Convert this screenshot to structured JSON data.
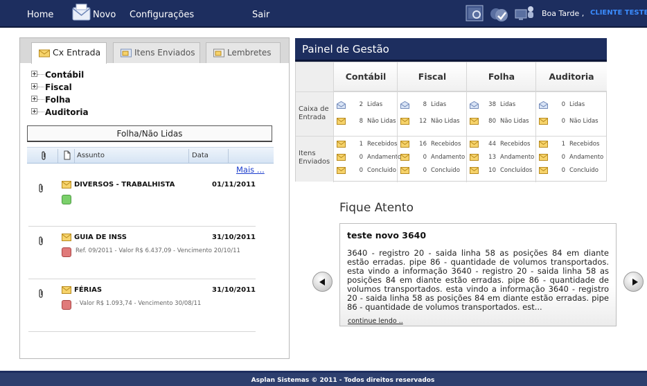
{
  "nav": {
    "home": "Home",
    "novo": "Novo",
    "config": "Configurações",
    "sair": "Sair",
    "greeting": "Boa Tarde ,",
    "client": "CLIENTE TESTE"
  },
  "tabs": [
    {
      "label": "Cx Entrada",
      "active": true
    },
    {
      "label": "Itens Enviados",
      "active": false
    },
    {
      "label": "Lembretes",
      "active": false
    }
  ],
  "tree": [
    "Contábil",
    "Fiscal",
    "Folha",
    "Auditoria"
  ],
  "folder_title": "Folha/Não Lidas",
  "grid": {
    "col_subject": "Assunto",
    "col_date": "Data",
    "more": "Mais ..."
  },
  "messages": [
    {
      "subject": "DIVERSOS - TRABALHISTA",
      "date": "01/11/2011",
      "detail": "",
      "status": "green"
    },
    {
      "subject": "GUIA DE INSS",
      "date": "31/10/2011",
      "detail": "Ref. 09/2011 - Valor R$ 6.437,09 - Vencimento 20/10/11",
      "status": "red"
    },
    {
      "subject": "FÉRIAS",
      "date": "31/10/2011",
      "detail": "- Valor R$ 1.093,74 - Vencimento 30/08/11",
      "status": "red"
    }
  ],
  "painel": {
    "title": "Painel de Gestão",
    "columns": [
      "Contábil",
      "Fiscal",
      "Folha",
      "Auditoria"
    ],
    "row_caixa": "Caixa de Entrada",
    "row_itens": "Itens Enviados",
    "lidas": [
      "2",
      "8",
      "38",
      "0"
    ],
    "nao_lidas": [
      "8",
      "12",
      "80",
      "0"
    ],
    "recebidos": [
      "1",
      "16",
      "44",
      "1"
    ],
    "andamento": [
      "0",
      "0",
      "13",
      "0"
    ],
    "concluido": [
      "0",
      "0",
      "10",
      "0"
    ],
    "labels": {
      "lidas": "Lidas",
      "nao_lidas": "Não Lidas",
      "recebidos": "Recebidos",
      "andamento": "Andamento",
      "concluido": "Concluido",
      "concluidos": "Concluídos"
    }
  },
  "fique": {
    "title": "Fique Atento",
    "news_title": "teste novo 3640",
    "news_body": "3640 - registro 20 - saida linha 58 as posições 84 em diante estão erradas. pipe 86 - quantidade de volumos transportados. esta vindo a informação 3640 - registro 20 - saida linha 58 as posições 84 em diante estão erradas. pipe 86 - quantidade de volumos transportados. esta vindo a informação 3640 - registro 20 - saida linha 58 as posições 84 em diante estão erradas. pipe 86 - quantidade de volumos transportados. est...",
    "more": "continue lendo .."
  },
  "footer": "Asplan Sistemas © 2011 - Todos direitos reservados",
  "colors": {
    "navy": "#1d2e5f",
    "link": "#1a3ccc",
    "client": "#3b8cff",
    "status_green": "#7bd06b",
    "status_red": "#e07a7a"
  }
}
